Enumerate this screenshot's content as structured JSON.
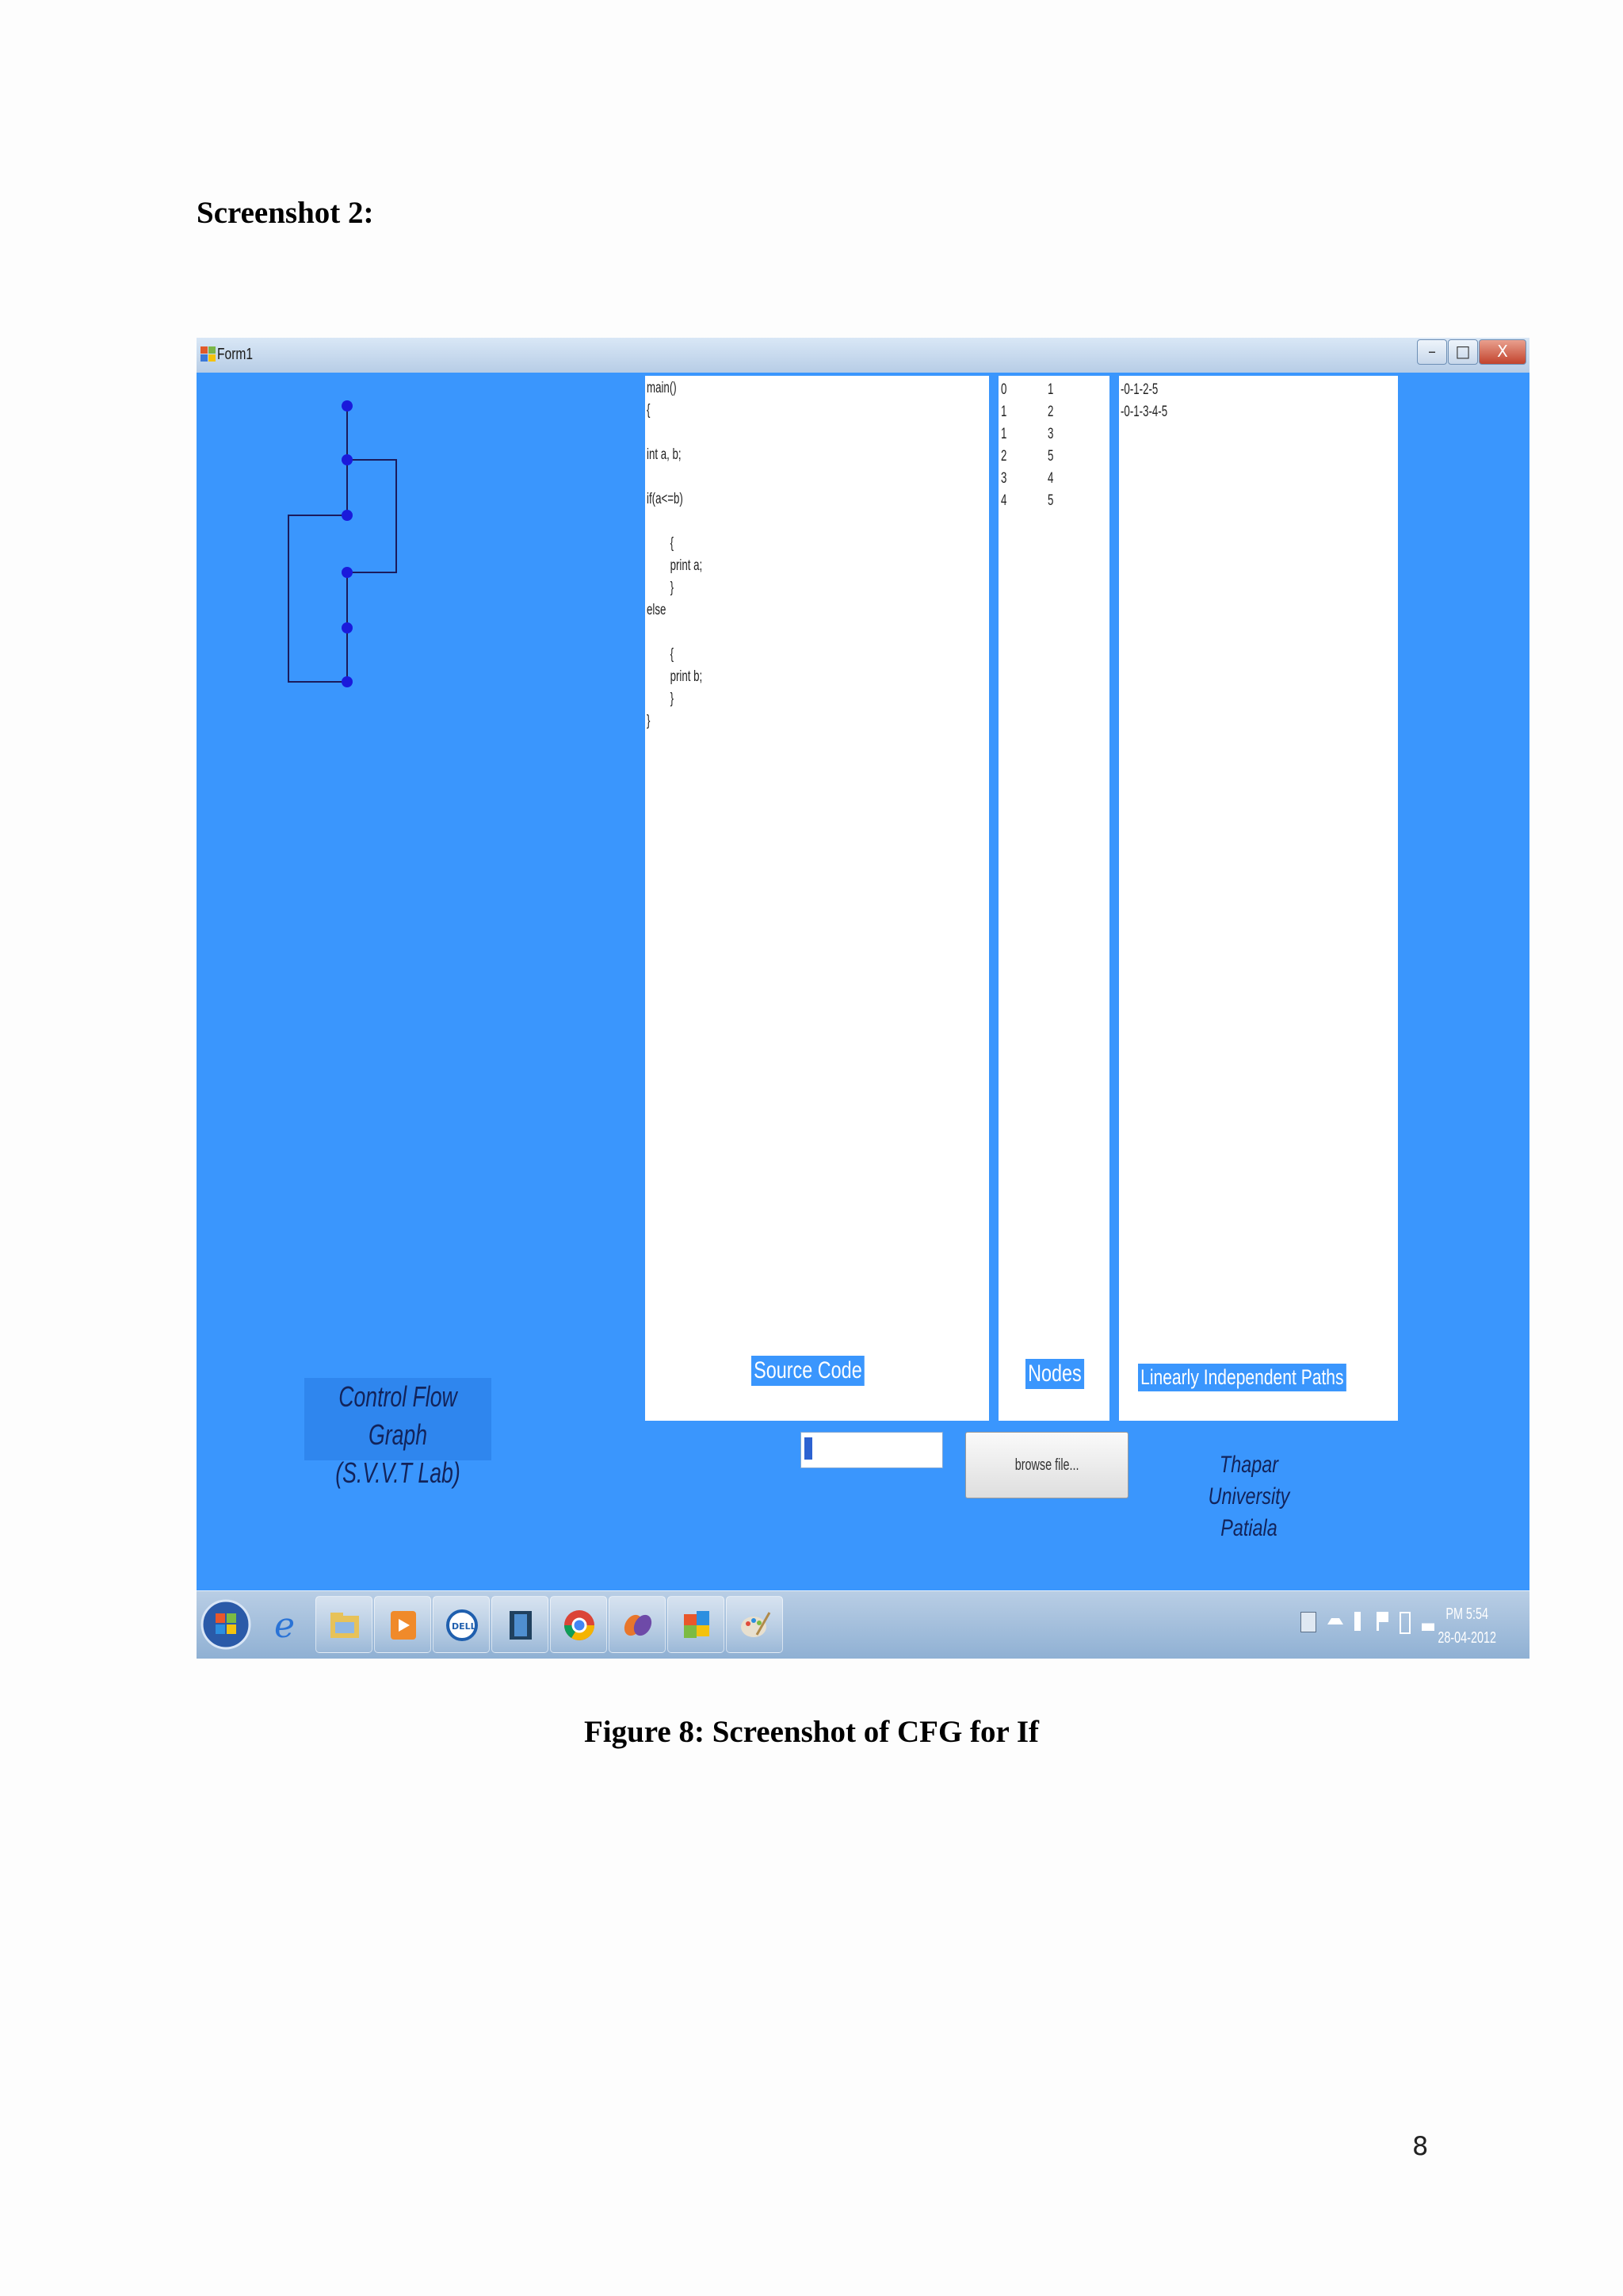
{
  "document": {
    "heading": "Screenshot 2:",
    "caption": "Figure 8: Screenshot of CFG for If",
    "page_number": "8"
  },
  "window": {
    "title": "Form1",
    "buttons": {
      "minimize": "–",
      "maximize": "□",
      "close": "X"
    }
  },
  "source_panel": {
    "code": "main()\n{\n\nint a, b;\n\nif(a<=b)\n\n\t{\n\tprint a;\n\t}\nelse\n\n\t{\n\tprint b;\n\t}\n}",
    "label": "Source Code"
  },
  "nodes_panel": {
    "from": "0\n1\n1\n2\n3\n4",
    "to": "1\n2\n3\n5\n4\n5",
    "label": "Nodes"
  },
  "paths_panel": {
    "paths": "-0-1-2-5\n-0-1-3-4-5",
    "label": "Linearly Independent Paths"
  },
  "cfg_label": {
    "line1": "Control Flow Graph",
    "line2": "(S.V.V.T Lab)"
  },
  "file_input": {
    "value": ""
  },
  "browse_button": {
    "label": "browse file..."
  },
  "institution": {
    "line1": "Thapar University",
    "line2": "Patiala"
  },
  "taskbar": {
    "items": [
      "start-orb-icon",
      "internet-explorer-icon",
      "file-explorer-icon",
      "media-player-icon",
      "dell-icon",
      "app-icon",
      "chrome-icon",
      "visual-studio-icon",
      "office-icon",
      "paint-icon"
    ],
    "clock_time": "PM 5:54",
    "clock_date": "28-04-2012"
  },
  "colors": {
    "form_background": "#3a96fd",
    "graph_nodes": "#1a1adb",
    "label_text": "#12235a"
  }
}
